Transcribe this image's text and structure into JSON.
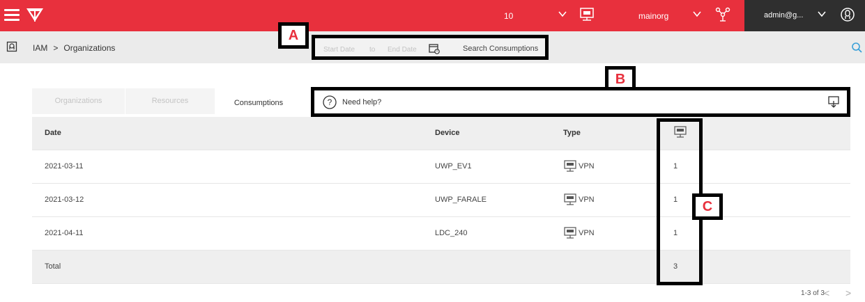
{
  "topbar": {
    "count": "10",
    "org_name": "mainorg",
    "user": "admin@g...",
    "accent": "#e8303d"
  },
  "breadcrumb": {
    "root": "IAM",
    "separator": ">",
    "current": "Organizations"
  },
  "date_filter": {
    "start_placeholder": "Start Date",
    "to_label": "to",
    "end_placeholder": "End Date",
    "search_label": "Search Consumptions"
  },
  "tabs": [
    {
      "label": "Organizations"
    },
    {
      "label": "Resources"
    },
    {
      "label": "Consumptions"
    }
  ],
  "help": {
    "text": "Need help?"
  },
  "table": {
    "headers": {
      "date": "Date",
      "device": "Device",
      "type": "Type"
    },
    "rows": [
      {
        "date": "2021-03-11",
        "device": "UWP_EV1",
        "type": "VPN",
        "value": "1"
      },
      {
        "date": "2021-03-12",
        "device": "UWP_FARALE",
        "type": "VPN",
        "value": "1"
      },
      {
        "date": "2021-04-11",
        "device": "LDC_240",
        "type": "VPN",
        "value": "1"
      }
    ],
    "total_label": "Total",
    "total_value": "3"
  },
  "labels": {
    "a": "A",
    "b": "B",
    "c": "C"
  },
  "pager": {
    "range": "1-3 of 3",
    "prev": "<",
    "next": ">"
  },
  "icons": [
    "menu-icon",
    "logo-icon",
    "chevron-down-icon",
    "vpn-icon",
    "network-icon",
    "user-icon",
    "home-icon",
    "search-icon",
    "calendar-icon",
    "help-icon",
    "download-icon"
  ]
}
